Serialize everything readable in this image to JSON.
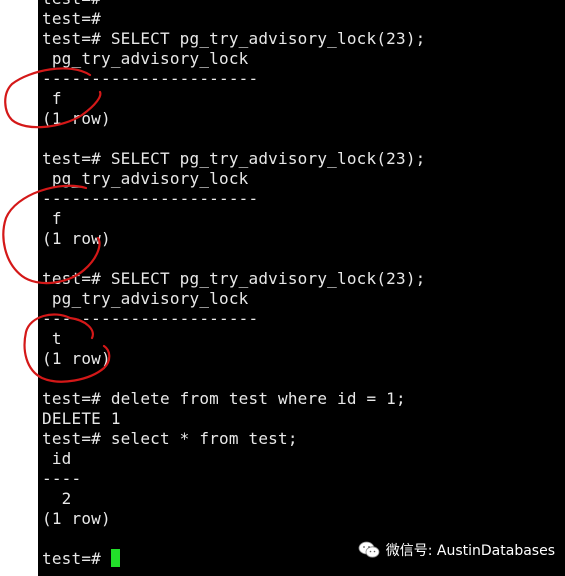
{
  "terminal": {
    "lines": [
      "test=#",
      "test=#",
      "test=# SELECT pg_try_advisory_lock(23);",
      " pg_try_advisory_lock",
      "----------------------",
      " f",
      "(1 row)",
      "",
      "test=# SELECT pg_try_advisory_lock(23);",
      " pg_try_advisory_lock",
      "----------------------",
      " f",
      "(1 row)",
      "",
      "test=# SELECT pg_try_advisory_lock(23);",
      " pg_try_advisory_lock",
      "----------------------",
      " t",
      "(1 row)",
      "",
      "test=# delete from test where id = 1;",
      "DELETE 1",
      "test=# select * from test;",
      " id",
      "----",
      "  2",
      "(1 row)",
      "",
      "test=# "
    ],
    "cursor_color": "#22e02a",
    "background": "#000000",
    "foreground": "#e8e8e8"
  },
  "annotations": {
    "color": "#d41818",
    "count": 3
  },
  "watermark": {
    "icon": "wechat-icon",
    "text": "微信号: AustinDatabases"
  }
}
